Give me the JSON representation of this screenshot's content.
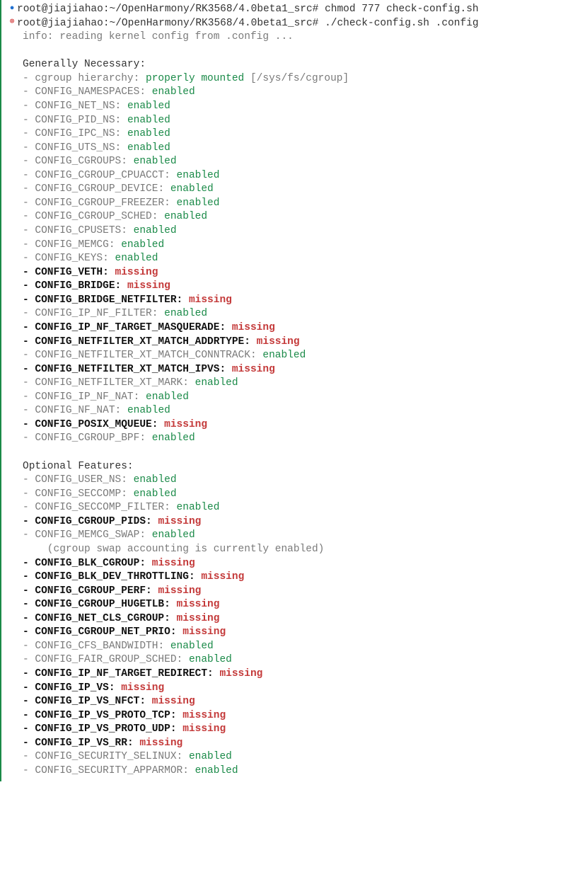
{
  "prompt_line1": {
    "bullet": "●",
    "prompt": "root@jiajiahao:~/OpenHarmony/RK3568/4.0beta1_src# ",
    "cmd": "chmod 777 check-config.sh"
  },
  "prompt_line2": {
    "bullet": "⊗",
    "prompt": "root@jiajiahao:~/OpenHarmony/RK3568/4.0beta1_src# ",
    "cmd": "./check-config.sh .config"
  },
  "info_line": "info: reading kernel config from .config ...",
  "section1": {
    "title": "Generally Necessary:",
    "cgroup": {
      "prefix": "- cgroup hierarchy: ",
      "status": "properly mounted",
      "suffix": " [/sys/fs/cgroup]"
    },
    "items": [
      {
        "name": "CONFIG_NAMESPACES",
        "status": "enabled",
        "bold": false
      },
      {
        "name": "CONFIG_NET_NS",
        "status": "enabled",
        "bold": false
      },
      {
        "name": "CONFIG_PID_NS",
        "status": "enabled",
        "bold": false
      },
      {
        "name": "CONFIG_IPC_NS",
        "status": "enabled",
        "bold": false
      },
      {
        "name": "CONFIG_UTS_NS",
        "status": "enabled",
        "bold": false
      },
      {
        "name": "CONFIG_CGROUPS",
        "status": "enabled",
        "bold": false
      },
      {
        "name": "CONFIG_CGROUP_CPUACCT",
        "status": "enabled",
        "bold": false
      },
      {
        "name": "CONFIG_CGROUP_DEVICE",
        "status": "enabled",
        "bold": false
      },
      {
        "name": "CONFIG_CGROUP_FREEZER",
        "status": "enabled",
        "bold": false
      },
      {
        "name": "CONFIG_CGROUP_SCHED",
        "status": "enabled",
        "bold": false
      },
      {
        "name": "CONFIG_CPUSETS",
        "status": "enabled",
        "bold": false
      },
      {
        "name": "CONFIG_MEMCG",
        "status": "enabled",
        "bold": false
      },
      {
        "name": "CONFIG_KEYS",
        "status": "enabled",
        "bold": false
      },
      {
        "name": "CONFIG_VETH",
        "status": "missing",
        "bold": true
      },
      {
        "name": "CONFIG_BRIDGE",
        "status": "missing",
        "bold": true
      },
      {
        "name": "CONFIG_BRIDGE_NETFILTER",
        "status": "missing",
        "bold": true
      },
      {
        "name": "CONFIG_IP_NF_FILTER",
        "status": "enabled",
        "bold": false
      },
      {
        "name": "CONFIG_IP_NF_TARGET_MASQUERADE",
        "status": "missing",
        "bold": true
      },
      {
        "name": "CONFIG_NETFILTER_XT_MATCH_ADDRTYPE",
        "status": "missing",
        "bold": true
      },
      {
        "name": "CONFIG_NETFILTER_XT_MATCH_CONNTRACK",
        "status": "enabled",
        "bold": false
      },
      {
        "name": "CONFIG_NETFILTER_XT_MATCH_IPVS",
        "status": "missing",
        "bold": true
      },
      {
        "name": "CONFIG_NETFILTER_XT_MARK",
        "status": "enabled",
        "bold": false
      },
      {
        "name": "CONFIG_IP_NF_NAT",
        "status": "enabled",
        "bold": false
      },
      {
        "name": "CONFIG_NF_NAT",
        "status": "enabled",
        "bold": false
      },
      {
        "name": "CONFIG_POSIX_MQUEUE",
        "status": "missing",
        "bold": true
      },
      {
        "name": "CONFIG_CGROUP_BPF",
        "status": "enabled",
        "bold": false
      }
    ]
  },
  "section2": {
    "title": "Optional Features:",
    "items": [
      {
        "name": "CONFIG_USER_NS",
        "status": "enabled",
        "bold": false
      },
      {
        "name": "CONFIG_SECCOMP",
        "status": "enabled",
        "bold": false
      },
      {
        "name": "CONFIG_SECCOMP_FILTER",
        "status": "enabled",
        "bold": false
      },
      {
        "name": "CONFIG_CGROUP_PIDS",
        "status": "missing",
        "bold": true
      },
      {
        "name": "CONFIG_MEMCG_SWAP",
        "status": "enabled",
        "bold": false,
        "note": "    (cgroup swap accounting is currently enabled)"
      },
      {
        "name": "CONFIG_BLK_CGROUP",
        "status": "missing",
        "bold": true
      },
      {
        "name": "CONFIG_BLK_DEV_THROTTLING",
        "status": "missing",
        "bold": true
      },
      {
        "name": "CONFIG_CGROUP_PERF",
        "status": "missing",
        "bold": true
      },
      {
        "name": "CONFIG_CGROUP_HUGETLB",
        "status": "missing",
        "bold": true
      },
      {
        "name": "CONFIG_NET_CLS_CGROUP",
        "status": "missing",
        "bold": true
      },
      {
        "name": "CONFIG_CGROUP_NET_PRIO",
        "status": "missing",
        "bold": true
      },
      {
        "name": "CONFIG_CFS_BANDWIDTH",
        "status": "enabled",
        "bold": false
      },
      {
        "name": "CONFIG_FAIR_GROUP_SCHED",
        "status": "enabled",
        "bold": false
      },
      {
        "name": "CONFIG_IP_NF_TARGET_REDIRECT",
        "status": "missing",
        "bold": true
      },
      {
        "name": "CONFIG_IP_VS",
        "status": "missing",
        "bold": true
      },
      {
        "name": "CONFIG_IP_VS_NFCT",
        "status": "missing",
        "bold": true
      },
      {
        "name": "CONFIG_IP_VS_PROTO_TCP",
        "status": "missing",
        "bold": true
      },
      {
        "name": "CONFIG_IP_VS_PROTO_UDP",
        "status": "missing",
        "bold": true
      },
      {
        "name": "CONFIG_IP_VS_RR",
        "status": "missing",
        "bold": true
      },
      {
        "name": "CONFIG_SECURITY_SELINUX",
        "status": "enabled",
        "bold": false
      },
      {
        "name": "CONFIG_SECURITY_APPARMOR",
        "status": "enabled",
        "bold": false
      }
    ]
  }
}
